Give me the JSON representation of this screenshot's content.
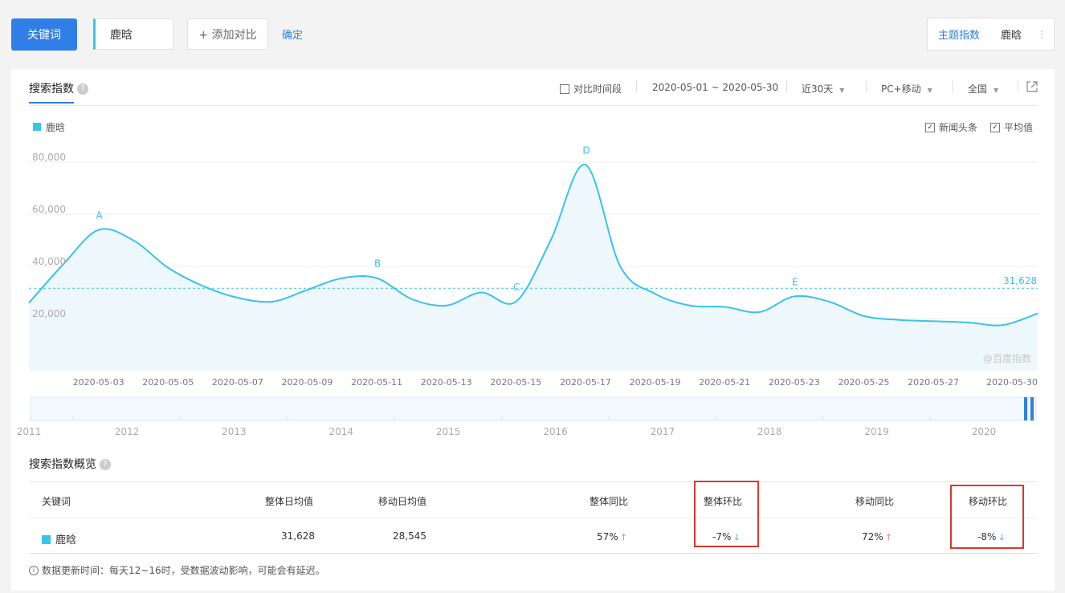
{
  "topbar": {
    "keyword_button": "关键词",
    "keyword_value": "鹿晗",
    "add_compare": "+ 添加对比",
    "confirm": "确定",
    "topic_index": "主题指数",
    "topic_keyword": "鹿晗",
    "more": "⋮"
  },
  "panel": {
    "tab_title": "搜索指数",
    "help": "?",
    "compare_period": "对比时间段",
    "date_range": "2020-05-01 ~ 2020-05-30",
    "period_select": "近30天",
    "device_select": "PC+移动",
    "region_select": "全国",
    "export_icon": "export-icon"
  },
  "options": {
    "news_headlines": "新闻头条",
    "news_checked": true,
    "average": "平均值",
    "average_checked": true
  },
  "chart_data": {
    "type": "area",
    "series": [
      {
        "name": "鹿晗",
        "color": "#39c3ea",
        "x": [
          "2020-05-01",
          "2020-05-02",
          "2020-05-03",
          "2020-05-04",
          "2020-05-05",
          "2020-05-06",
          "2020-05-07",
          "2020-05-08",
          "2020-05-09",
          "2020-05-10",
          "2020-05-11",
          "2020-05-12",
          "2020-05-13",
          "2020-05-14",
          "2020-05-15",
          "2020-05-16",
          "2020-05-17",
          "2020-05-18",
          "2020-05-19",
          "2020-05-20",
          "2020-05-21",
          "2020-05-22",
          "2020-05-23",
          "2020-05-24",
          "2020-05-25",
          "2020-05-26",
          "2020-05-27",
          "2020-05-28",
          "2020-05-29",
          "2020-05-30"
        ],
        "values": [
          26000,
          41000,
          54000,
          50000,
          39500,
          32500,
          28000,
          26500,
          31000,
          35500,
          35500,
          27500,
          25000,
          30000,
          26500,
          50000,
          79000,
          40000,
          29500,
          25000,
          24500,
          22500,
          28500,
          26500,
          21000,
          19500,
          19000,
          18500,
          17500,
          22000
        ]
      }
    ],
    "x_tick_labels": [
      "2020-05-03",
      "2020-05-05",
      "2020-05-07",
      "2020-05-09",
      "2020-05-11",
      "2020-05-13",
      "2020-05-15",
      "2020-05-17",
      "2020-05-19",
      "2020-05-21",
      "2020-05-23",
      "2020-05-25",
      "2020-05-27",
      "2020-05-30"
    ],
    "y_ticks": [
      20000,
      40000,
      60000,
      80000
    ],
    "y_tick_labels": [
      "20,000",
      "40,000",
      "60,000",
      "80,000"
    ],
    "ylim": [
      0,
      80000
    ],
    "average": 31628,
    "average_label": "31,628",
    "annotations": [
      {
        "label": "A",
        "x": "2020-05-03"
      },
      {
        "label": "B",
        "x": "2020-05-11"
      },
      {
        "label": "C",
        "x": "2020-05-15"
      },
      {
        "label": "D",
        "x": "2020-05-17"
      },
      {
        "label": "E",
        "x": "2020-05-23"
      }
    ],
    "watermark": "@百度指数",
    "grid": true,
    "timeline_years": [
      "2011",
      "2012",
      "2013",
      "2014",
      "2015",
      "2016",
      "2017",
      "2018",
      "2019",
      "2020"
    ]
  },
  "overview": {
    "title": "搜索指数概览",
    "headers": {
      "keyword": "关键词",
      "overall_daily": "整体日均值",
      "mobile_daily": "移动日均值",
      "overall_yoy": "整体同比",
      "overall_mom": "整体环比",
      "mobile_yoy": "移动同比",
      "mobile_mom": "移动环比"
    },
    "row": {
      "keyword": "鹿晗",
      "overall_daily": "31,628",
      "mobile_daily": "28,545",
      "overall_yoy": "57%",
      "overall_mom": "-7%",
      "mobile_yoy": "72%",
      "mobile_mom": "-8%"
    },
    "footnote": "数据更新时间：每天12~16时，受数据波动影响，可能会有延迟。"
  }
}
